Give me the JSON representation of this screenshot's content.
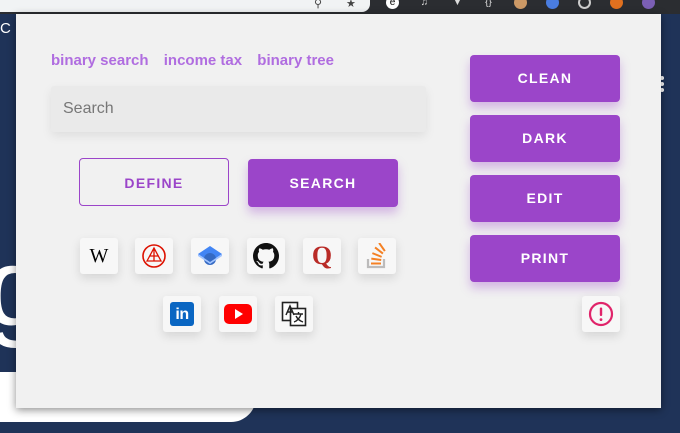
{
  "browser": {
    "peek_text": "C",
    "big_peek_glyph": "g"
  },
  "popup": {
    "suggestions": [
      "binary search",
      "income tax",
      "binary tree"
    ],
    "search": {
      "placeholder": "Search",
      "value": ""
    },
    "buttons": {
      "define": "DEFINE",
      "search": "SEARCH"
    },
    "side_buttons": [
      "CLEAN",
      "DARK",
      "EDIT",
      "PRINT"
    ],
    "sites_row1": [
      {
        "name": "wikipedia-icon",
        "glyph": "W"
      },
      {
        "name": "wolfram-icon"
      },
      {
        "name": "google-scholar-icon"
      },
      {
        "name": "github-icon"
      },
      {
        "name": "quora-icon",
        "glyph": "Q"
      },
      {
        "name": "stackoverflow-icon"
      }
    ],
    "sites_row2": [
      {
        "name": "linkedin-icon",
        "glyph": "in"
      },
      {
        "name": "youtube-icon"
      },
      {
        "name": "google-translate-icon"
      }
    ],
    "report_icon": "alert-circle-icon"
  },
  "colors": {
    "accent": "#9b45c9",
    "suggestion": "#b06de0",
    "page_bg": "#1f3358",
    "popup_bg": "#f1f1f1"
  }
}
